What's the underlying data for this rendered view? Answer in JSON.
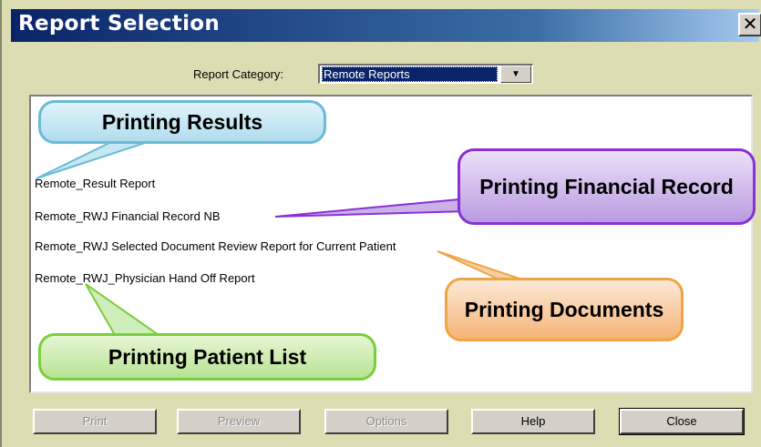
{
  "window": {
    "title": "Report Selection",
    "close_label": "✕"
  },
  "category": {
    "label": "Report Category:",
    "value": "Remote Reports",
    "dropdown_arrow": "▼"
  },
  "reports": [
    "Remote_Result Report",
    "Remote_RWJ Financial Record NB",
    "Remote_RWJ Selected Document Review Report for Current Patient",
    "Remote_RWJ_Physician Hand Off Report"
  ],
  "callouts": {
    "results": "Printing Results",
    "financial": "Printing Financial Record",
    "documents": "Printing Documents",
    "patient": "Printing Patient List"
  },
  "buttons": {
    "print": "Print",
    "preview": "Preview",
    "options": "Options",
    "help": "Help",
    "close": "Close"
  },
  "colors": {
    "titlebar_start": "#0a246a",
    "dialog_background": "#ddddb4",
    "callout_results": "#6bbad6",
    "callout_financial": "#8b2fd8",
    "callout_documents": "#f0a444",
    "callout_patient": "#7acd3e"
  }
}
